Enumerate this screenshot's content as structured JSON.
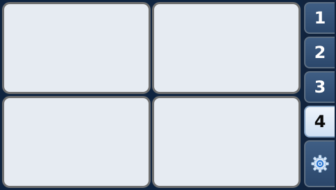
{
  "tabs": [
    {
      "label": "1",
      "active": false
    },
    {
      "label": "2",
      "active": false
    },
    {
      "label": "3",
      "active": false
    },
    {
      "label": "4",
      "active": true
    }
  ],
  "settings": {
    "icon": "gear-icon"
  },
  "colors": {
    "background": "#0f2440",
    "panel_fill": "#e6ebf2",
    "panel_border": "#707070",
    "tab_fill": "#2f4e74",
    "tab_active_fill": "#dbe8f6",
    "gear_accent": "#4aa3ff"
  }
}
